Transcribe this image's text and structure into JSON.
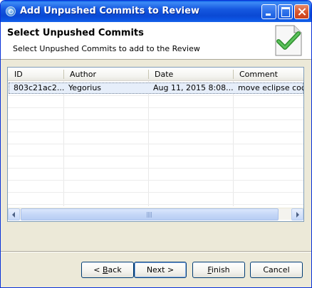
{
  "window": {
    "title": "Add Unpushed Commits to Review"
  },
  "banner": {
    "title": "Select Unpushed Commits",
    "description": "Select Unpushed Commits to add to the Review",
    "image_icon": "check-document-icon"
  },
  "table": {
    "columns": [
      "ID",
      "Author",
      "Date",
      "Comment"
    ],
    "rows": [
      {
        "id": "803c21ac2...",
        "author": "Yegorius",
        "date": "Aug 11, 2015 8:08...",
        "comment": "move eclipse code"
      }
    ]
  },
  "buttons": {
    "back": {
      "mnemonic": "B",
      "rest": "ack",
      "prefix": "< "
    },
    "next": "Next >",
    "finish": {
      "mnemonic": "F",
      "rest": "inish"
    },
    "cancel": "Cancel"
  },
  "colors": {
    "titlebar": "#0a49d4",
    "dialog_bg": "#ece9d8",
    "selection": "#e6eefa",
    "check_green": "#3aa03a"
  }
}
